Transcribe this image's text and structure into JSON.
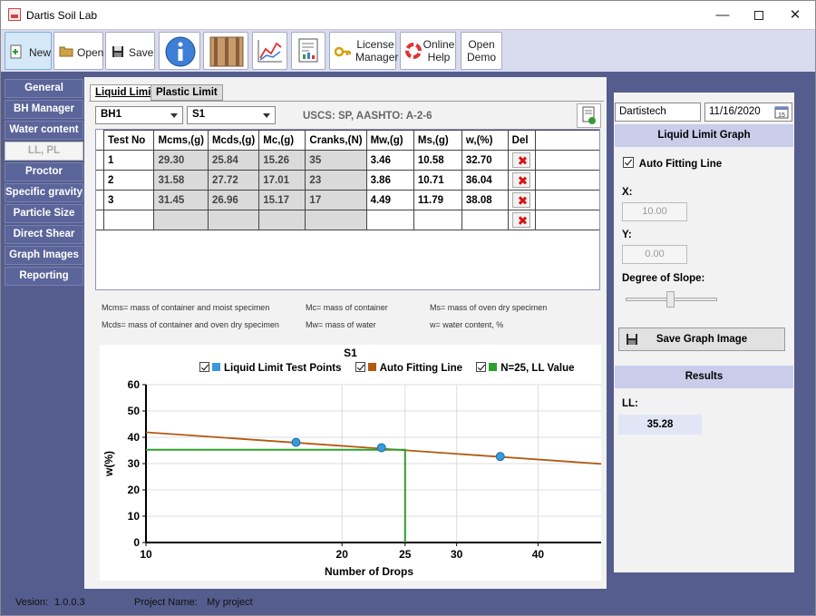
{
  "window": {
    "title": "Dartis Soil Lab"
  },
  "toolbar": {
    "new_label": "New",
    "open_label": "Open",
    "save_label": "Save",
    "license_label_1": "License",
    "license_label_2": "Manager",
    "help_label_1": "Online",
    "help_label_2": "Help",
    "demo_label_1": "Open",
    "demo_label_2": "Demo"
  },
  "sidebar": {
    "items": [
      {
        "label": "General"
      },
      {
        "label": "BH Manager"
      },
      {
        "label": "Water content"
      },
      {
        "label": "LL, PL"
      },
      {
        "label": "Proctor"
      },
      {
        "label": "Specific gravity"
      },
      {
        "label": "Particle Size"
      },
      {
        "label": "Direct Shear"
      },
      {
        "label": "Graph Images"
      },
      {
        "label": "Reporting"
      }
    ]
  },
  "tabs": {
    "liquid_limit": "Liquid Limit",
    "plastic_limit": "Plastic Limit"
  },
  "selectors": {
    "borehole": "BH1",
    "sample": "S1",
    "classification": "USCS: SP, AASHTO: A-2-6"
  },
  "grid": {
    "columns": [
      "Test No",
      "Mcms,(g)",
      "Mcds,(g)",
      "Mc,(g)",
      "Cranks,(N)",
      "Mw,(g)",
      "Ms,(g)",
      "w,(%)",
      "Del"
    ],
    "rows": [
      [
        "1",
        "29.30",
        "25.84",
        "15.26",
        "35",
        "3.46",
        "10.58",
        "32.70"
      ],
      [
        "2",
        "31.58",
        "27.72",
        "17.01",
        "23",
        "3.86",
        "10.71",
        "36.04"
      ],
      [
        "3",
        "31.45",
        "26.96",
        "15.17",
        "17",
        "4.49",
        "11.79",
        "38.08"
      ]
    ]
  },
  "legend": {
    "mcms": "Mcms= mass of container and moist specimen",
    "mc": "Mc= mass of container",
    "ms": "Ms= mass of oven dry specimen",
    "mcds": "Mcds= mass of container and oven dry specimen",
    "mw": "Mw= mass of water",
    "w": "w= water content, %"
  },
  "colors": {
    "points": "#3a9ad9",
    "fit_line": "#b05a12",
    "ll_line": "#2ca02c"
  },
  "chart_data": {
    "type": "scatter",
    "title": "S1",
    "xlabel": "Number of Drops",
    "ylabel": "w(%)",
    "x_scale": "log",
    "xlim": [
      10,
      50
    ],
    "ylim": [
      0,
      60
    ],
    "x_ticks": [
      "10",
      "20",
      "25",
      "30",
      "40"
    ],
    "y_ticks": [
      "0",
      "10",
      "20",
      "30",
      "40",
      "50",
      "60"
    ],
    "legend": {
      "points": "Liquid Limit Test Points",
      "fit": "Auto Fitting Line",
      "ll": "N=25, LL Value"
    },
    "series": [
      {
        "name": "Liquid Limit Test Points",
        "x": [
          17,
          23,
          35
        ],
        "y": [
          38.08,
          36.04,
          32.7
        ]
      },
      {
        "name": "Auto Fitting Line",
        "x": [
          10,
          50
        ],
        "y": [
          41.9,
          29.9
        ]
      },
      {
        "name": "N=25, LL Value",
        "x": [
          10,
          25,
          25
        ],
        "y": [
          35.28,
          35.28,
          0
        ]
      }
    ]
  },
  "right": {
    "company": "Dartistech",
    "date": "11/16/2020",
    "calendar_day": "15",
    "graph_header": "Liquid Limit Graph",
    "auto_fit_label": "Auto Fitting Line",
    "x_label": "X:",
    "x_value": "10.00",
    "y_label": "Y:",
    "y_value": "0.00",
    "slope_label": "Degree of Slope:",
    "save_graph_label": "Save Graph Image",
    "results_header": "Results",
    "ll_label": "LL:",
    "ll_value": "35.28"
  },
  "status": {
    "version_label": "Vesion:",
    "version": "1.0.0.3",
    "project_label": "Project Name:",
    "project": "My project"
  }
}
